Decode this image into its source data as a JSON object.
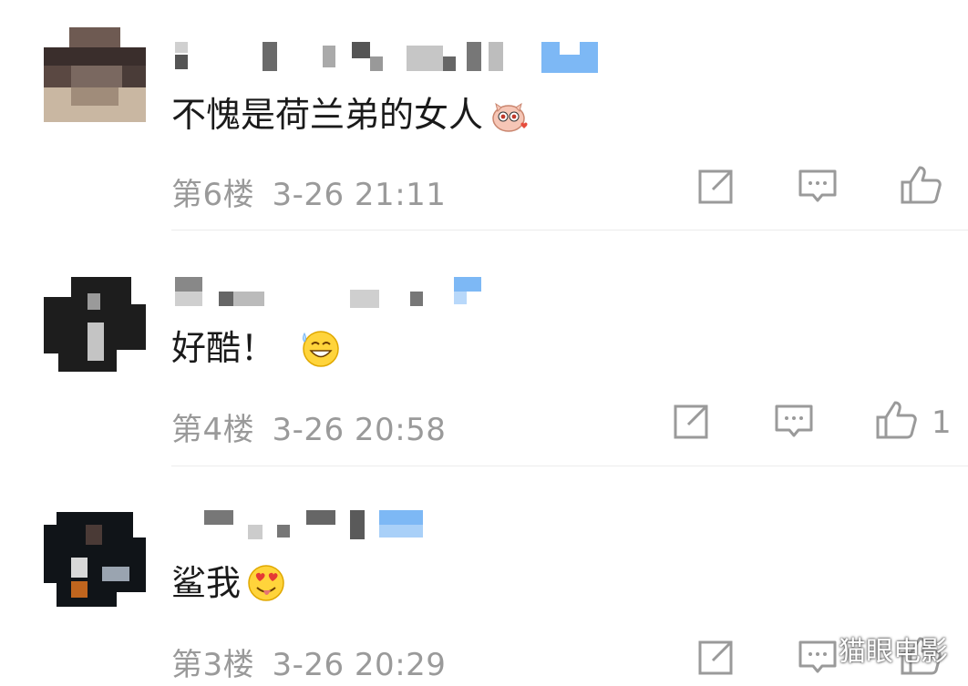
{
  "comments": [
    {
      "text": "不愧是荷兰弟的女人",
      "emoji": "piglet-love-emoji",
      "floor": "第6楼",
      "time": "3-26 21:11",
      "likes": ""
    },
    {
      "text": "好酷！",
      "emoji": "grin-sweat-emoji",
      "floor": "第4楼",
      "time": "3-26 20:58",
      "likes": "1"
    },
    {
      "text": "鲨我",
      "emoji": "heart-eyes-tongue-emoji",
      "floor": "第3楼",
      "time": "3-26 20:29",
      "likes": ""
    }
  ],
  "icons": [
    "share-icon",
    "reply-icon",
    "like-icon"
  ],
  "colors": {
    "text": "#1a1a1a",
    "meta": "#9a9a9a",
    "divider": "#ececec",
    "vip_badge": "#7db8f5"
  },
  "watermark": "猫眼电影"
}
